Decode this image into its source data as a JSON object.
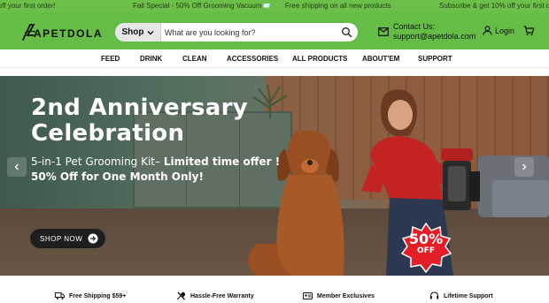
{
  "announcement_bar": {
    "messages": [
      "off your first order!",
      "Fall Special - 50% Off Grooming Vacuum📨",
      "Free shipping on all new products",
      "Subscribe & get 10% off your first or"
    ]
  },
  "header": {
    "logo_text": "APETDOLA",
    "search": {
      "category_label": "Shop",
      "placeholder": "What are you looking for?"
    },
    "contact": {
      "title": "Contact Us:",
      "email": "support@apetdola.com"
    },
    "login_label": "Login"
  },
  "nav": {
    "items": [
      "FEED",
      "DRINK",
      "CLEAN",
      "ACCESSORIES",
      "ALL PRODUCTS",
      "ABOUT'EM",
      "SUPPORT"
    ]
  },
  "hero": {
    "title_line1": "2nd Anniversary",
    "title_line2": "Celebration",
    "subtitle_prefix": "5-in-1 Pet Grooming Kit– ",
    "subtitle_bold": "Limited time offer !",
    "offer": "50% Off for One Month Only!",
    "cta_label": "SHOP NOW",
    "badge_value": "50%",
    "badge_off": "OFF"
  },
  "features": [
    {
      "label": "Free Shipping $59+",
      "icon": "truck-icon"
    },
    {
      "label": "Hassle-Free Warranty",
      "icon": "tools-icon"
    },
    {
      "label": "Member Exclusives",
      "icon": "id-card-icon"
    },
    {
      "label": "Lifetime Support",
      "icon": "headset-icon"
    }
  ],
  "colors": {
    "brand_green": "#65bc46",
    "announce_green": "#6cc04a",
    "badge_red": "#e41e26",
    "dark_button": "#1e1e1e"
  }
}
